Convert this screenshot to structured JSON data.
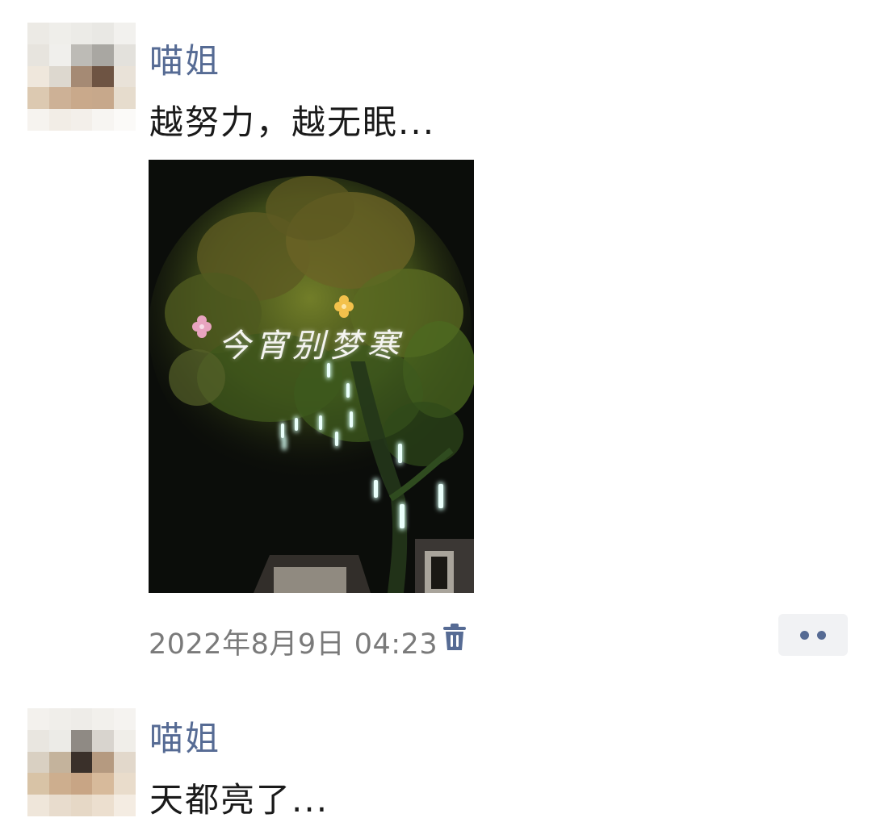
{
  "posts": [
    {
      "author": "喵姐",
      "text": "越努力，越无眠...",
      "photo": {
        "overlay_text": "今宵别梦寒"
      },
      "timestamp": "2022年8月9日 04:23",
      "icons": {
        "delete": "trash-icon",
        "more": "more-dots-icon"
      }
    },
    {
      "author": "喵姐",
      "text": "天都亮了..."
    }
  ],
  "colors": {
    "author": "#566b94",
    "body_text": "#1a1a1a",
    "timestamp": "#7a7a7a",
    "more_button_bg": "#f1f2f4"
  }
}
